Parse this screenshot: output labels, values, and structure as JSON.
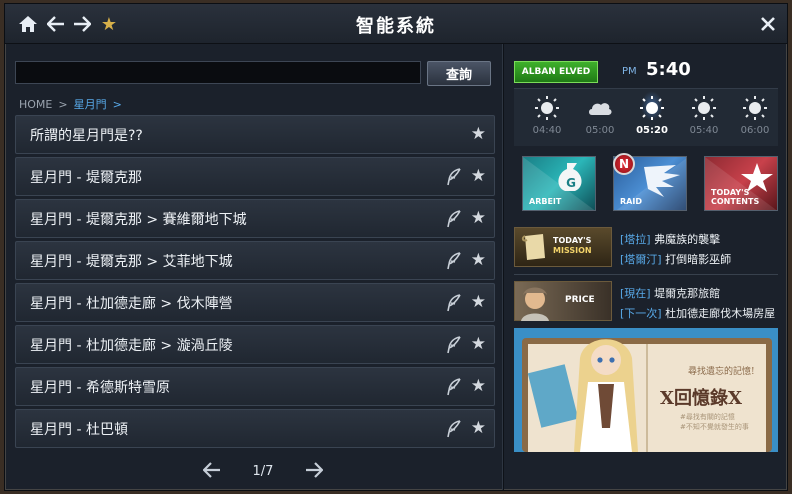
{
  "window": {
    "title": "智能系統"
  },
  "search": {
    "value": "",
    "button": "查詢"
  },
  "breadcrumb": {
    "home": "HOME",
    "current": "星月門"
  },
  "list": [
    {
      "label": "所謂的星月門是??",
      "feather": false
    },
    {
      "label": "星月門 - 堤爾克那",
      "feather": true
    },
    {
      "label": "星月門 - 堤爾克那 > 賽維爾地下城",
      "feather": true
    },
    {
      "label": "星月門 - 堤爾克那 > 艾菲地下城",
      "feather": true
    },
    {
      "label": "星月門 - 杜加德走廊 > 伐木陣營",
      "feather": true
    },
    {
      "label": "星月門 - 杜加德走廊 > 漩渦丘陵",
      "feather": true
    },
    {
      "label": "星月門 - 希德斯特雪原",
      "feather": true
    },
    {
      "label": "星月門 - 杜巴頓",
      "feather": true
    }
  ],
  "pager": {
    "page": "1/7"
  },
  "region": {
    "name": "ALBAN ELVED"
  },
  "clock": {
    "ampm": "PM",
    "time": "5:40"
  },
  "weather": [
    {
      "time": "04:40",
      "icon": "sun-icon",
      "active": false
    },
    {
      "time": "05:00",
      "icon": "cloud-icon",
      "active": false
    },
    {
      "time": "05:20",
      "icon": "sun-icon",
      "active": true
    },
    {
      "time": "05:40",
      "icon": "sun-icon",
      "active": false
    },
    {
      "time": "06:00",
      "icon": "sun-icon",
      "active": false
    }
  ],
  "buttons": {
    "arbeit": "ARBEIT",
    "raid": "RAID",
    "raid_badge": "N",
    "contents_1": "TODAY'S",
    "contents_2": "CONTENTS"
  },
  "mission": {
    "img_1": "TODAY'S",
    "img_2": "MISSION",
    "line1_tag": "[塔拉]",
    "line1_text": "弗魔族的襲擊",
    "line2_tag": "[塔爾汀]",
    "line2_text": "打倒暗影巫師"
  },
  "price": {
    "img": "PRICE",
    "line1_tag": "[現在]",
    "line1_text": "堤爾克那旅館",
    "line2_tag": "[下一次]",
    "line2_text": "杜加德走廊伐木場房屋"
  },
  "banner": {
    "tagline": "尋找遺忘的記憶!",
    "title": "X回憶錄X",
    "sub1": "#尋找有關的記憶",
    "sub2": "#不知不覺就發生的事"
  },
  "colors": {
    "accent": "#58a9e8",
    "region_green": "#3fb02c",
    "badge_red": "#e8303a"
  }
}
